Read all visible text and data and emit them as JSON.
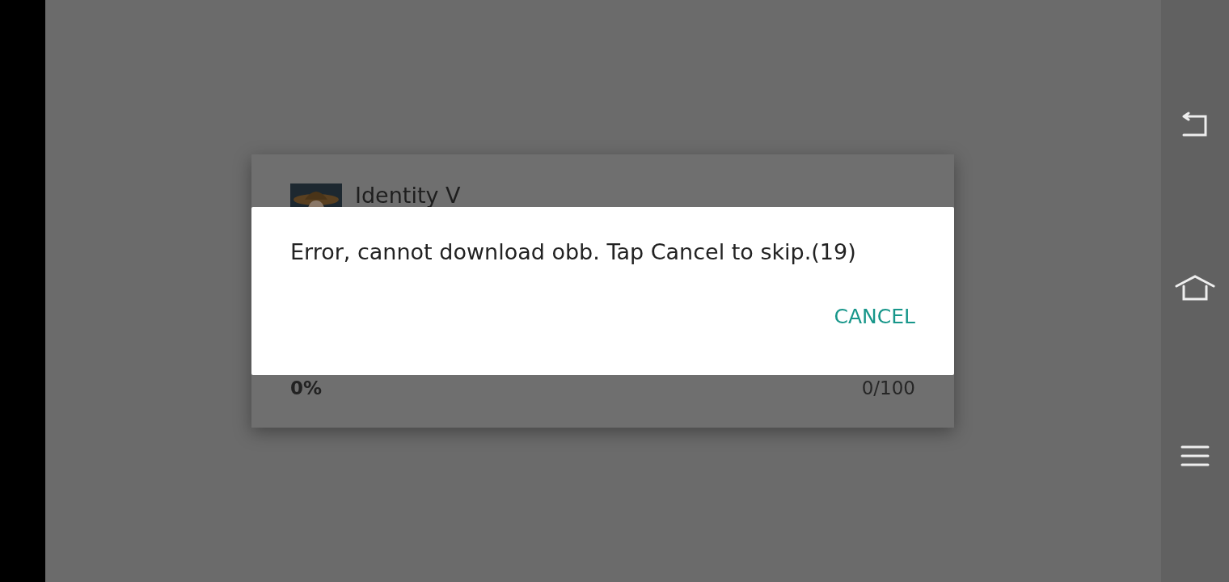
{
  "background_dialog": {
    "title": "Identity V",
    "progress_percent": "0%",
    "progress_count": "0/100"
  },
  "dialog": {
    "message": "Error, cannot download obb. Tap Cancel to skip.(19)",
    "buttons": [
      "CANCEL"
    ]
  }
}
